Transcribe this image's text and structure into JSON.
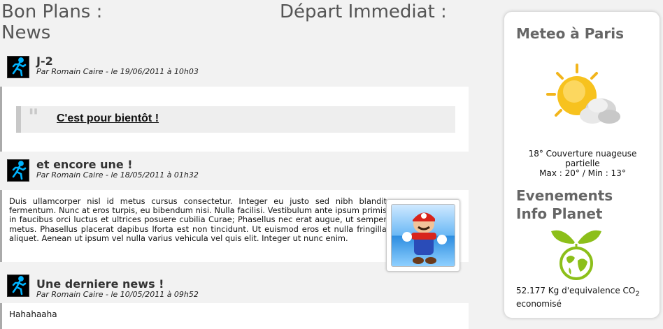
{
  "header": {
    "left_line1": "Bon Plans :",
    "left_line2": "News",
    "right": "Départ Immediat :"
  },
  "posts": [
    {
      "title": "J-2",
      "meta": "Par Romain Caire - le 19/06/2011 à 10h03",
      "quote": "C'est pour bientôt !"
    },
    {
      "title": "et encore une !",
      "meta": "Par Romain Caire - le 18/05/2011 à 01h32",
      "body": "Duis ullamcorper nisl id metus cursus consectetur. Integer eu justo sed nibh blandit fermentum. Nunc at eros turpis, eu bibendum nisi. Nulla facilisi. Vestibulum ante ipsum primis in faucibus orci luctus et ultrices posuere cubilia Curae; Phasellus nec erat augue, ut semper metus. Phasellus placerat dapibus lforta est non tincidunt. Ut euismod eros et nulla fringilla aliquet. Aenean ut ipsum vel nulla varius vehicula vel quis elit. Integer ut nunc enim."
    },
    {
      "title": "Une derniere news !",
      "meta": "Par Romain Caire - le 10/05/2011 à 09h52",
      "body": "Hahahaaha"
    }
  ],
  "sidebar": {
    "weather_title": "Meteo à Paris",
    "weather_line1": "18° Couverture nuageuse",
    "weather_line2": "partielle",
    "weather_line3": "Max : 20° / Min : 13°",
    "events_title_line1": "Evenements",
    "events_title_line2": "Info Planet",
    "co2_value": "52.177 Kg d'equivalence CO",
    "co2_sub": "2",
    "co2_suffix": "economisé"
  },
  "icons": {
    "avatar": "running-man-icon",
    "weather": "sun-cloud-icon",
    "planet": "leaf-globe-icon",
    "thumbnail": "mario-thumbnail"
  },
  "colors": {
    "accent_green": "#8cbf1a",
    "avatar_blue": "#00b4ff",
    "heading_gray": "#666666"
  }
}
